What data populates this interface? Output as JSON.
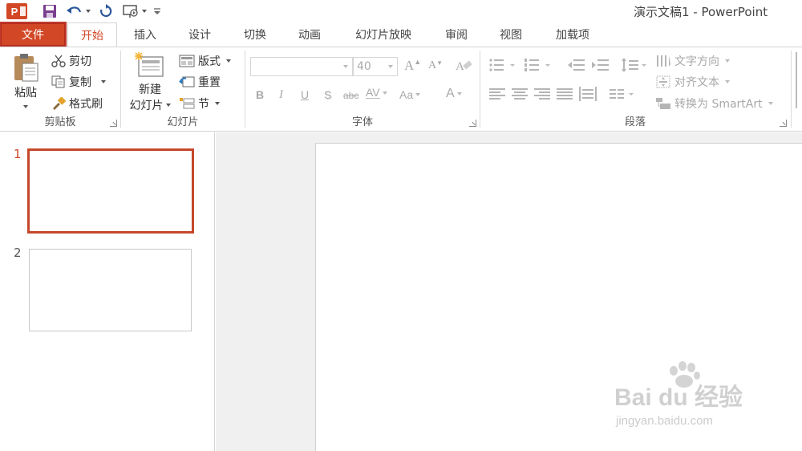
{
  "window": {
    "title": "演示文稿1 - PowerPoint"
  },
  "qat": {
    "logo_letter": "P"
  },
  "tabs": [
    {
      "label": "文件"
    },
    {
      "label": "开始"
    },
    {
      "label": "插入"
    },
    {
      "label": "设计"
    },
    {
      "label": "切换"
    },
    {
      "label": "动画"
    },
    {
      "label": "幻灯片放映"
    },
    {
      "label": "审阅"
    },
    {
      "label": "视图"
    },
    {
      "label": "加载项"
    }
  ],
  "clipboard": {
    "group_label": "剪贴板",
    "paste_line1": "粘贴",
    "cut": "剪切",
    "copy": "复制",
    "format_painter": "格式刷"
  },
  "slides": {
    "group_label": "幻灯片",
    "new_slide_line1": "新建",
    "new_slide_line2": "幻灯片",
    "layout": "版式",
    "reset": "重置",
    "section": "节"
  },
  "font": {
    "group_label": "字体",
    "font_size": "40",
    "grow": "A",
    "shrink": "A",
    "bold": "B",
    "italic": "I",
    "underline": "U",
    "shadow": "S",
    "strike": "abc",
    "spacing": "AV",
    "case": "Aa",
    "color": "A"
  },
  "paragraph": {
    "group_label": "段落",
    "text_direction": "文字方向",
    "align_text": "对齐文本",
    "smartart": "转换为 SmartArt"
  },
  "thumbnails": [
    {
      "number": "1"
    },
    {
      "number": "2"
    }
  ],
  "watermark": {
    "brand": "Bai du 经验",
    "url": "jingyan.baidu.com"
  },
  "colors": {
    "accent": "#d24726",
    "thumb_selected": "#c5482b",
    "file_tab_border": "#b22b20"
  }
}
